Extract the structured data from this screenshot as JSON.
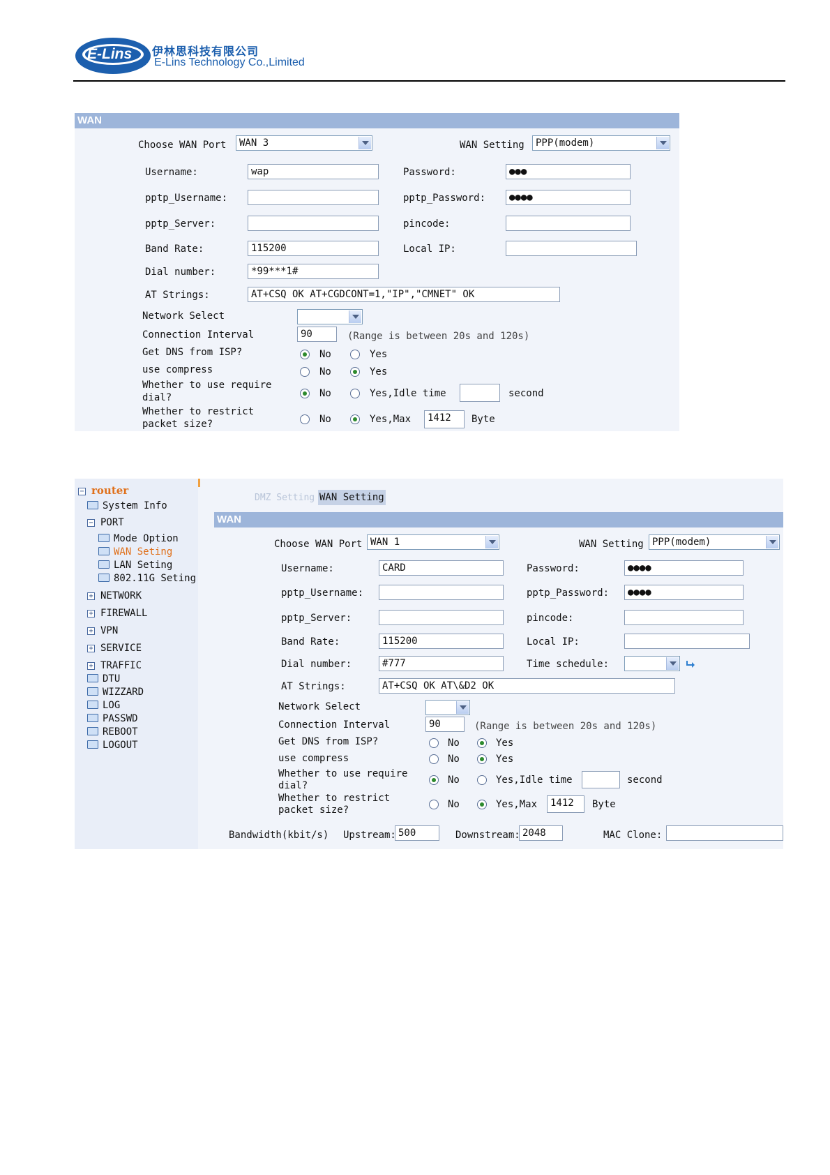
{
  "header": {
    "logo_text": "E-Lins",
    "company_cn": "伊林思科技有限公司",
    "company_en": "E-Lins Technology Co.,Limited"
  },
  "panel1": {
    "title": "WAN",
    "choose_wan_port_label": "Choose WAN Port",
    "choose_wan_port_value": "WAN 3",
    "wan_setting_label": "WAN Setting",
    "wan_setting_value": "PPP(modem)",
    "username_label": "Username:",
    "username_value": "wap",
    "password_label": "Password:",
    "password_value": "●●●",
    "pptp_username_label": "pptp_Username:",
    "pptp_username_value": "",
    "pptp_password_label": "pptp_Password:",
    "pptp_password_value": "●●●●",
    "pptp_server_label": "pptp_Server:",
    "pptp_server_value": "",
    "pincode_label": "pincode:",
    "pincode_value": "",
    "band_rate_label": "Band Rate:",
    "band_rate_value": "115200",
    "local_ip_label": "Local IP:",
    "local_ip_value": "",
    "dial_number_label": "Dial number:",
    "dial_number_value": "*99***1#",
    "at_strings_label": "AT Strings:",
    "at_strings_value": "AT+CSQ OK AT+CGDCONT=1,\"IP\",\"CMNET\" OK",
    "network_select_label": "Network Select",
    "network_select_value": "",
    "connection_interval_label": "Connection Interval",
    "connection_interval_value": "90",
    "range_note": "(Range is between 20s and 120s)",
    "dns_label": "Get DNS from ISP?",
    "compress_label": "use compress",
    "require_dial_label_1": "Whether to use require",
    "require_dial_label_2": "dial?",
    "restrict_label_1": "Whether to restrict",
    "restrict_label_2": "packet size?",
    "no": "No",
    "yes": "Yes",
    "yes_idle_time": "Yes,Idle time",
    "idle_value": "",
    "second": "second",
    "yes_max": "Yes,Max",
    "max_value": "1412",
    "byte": "Byte",
    "dns_choice": "No",
    "compress_choice": "Yes",
    "require_dial_choice": "No",
    "restrict_choice": "Yes"
  },
  "panel2": {
    "sidebar": {
      "root": "router",
      "items": [
        {
          "label": "System Info"
        },
        {
          "label": "PORT"
        },
        {
          "label": "Mode Option"
        },
        {
          "label": "WAN Seting"
        },
        {
          "label": "LAN Seting"
        },
        {
          "label": "802.11G Seting"
        },
        {
          "label": "NETWORK"
        },
        {
          "label": "FIREWALL"
        },
        {
          "label": "VPN"
        },
        {
          "label": "SERVICE"
        },
        {
          "label": "TRAFFIC"
        },
        {
          "label": "DTU"
        },
        {
          "label": "WIZZARD"
        },
        {
          "label": "LOG"
        },
        {
          "label": "PASSWD"
        },
        {
          "label": "REBOOT"
        },
        {
          "label": "LOGOUT"
        }
      ],
      "active_color": "#e0701a"
    },
    "tabs": {
      "dmz": "DMZ Setting",
      "wan": "WAN Setting"
    },
    "title": "WAN",
    "choose_wan_port_label": "Choose WAN Port",
    "choose_wan_port_value": "WAN 1",
    "wan_setting_label": "WAN Setting",
    "wan_setting_value": "PPP(modem)",
    "username_label": "Username:",
    "username_value": "CARD",
    "password_label": "Password:",
    "password_value": "●●●●",
    "pptp_username_label": "pptp_Username:",
    "pptp_username_value": "",
    "pptp_password_label": "pptp_Password:",
    "pptp_password_value": "●●●●",
    "pptp_server_label": "pptp_Server:",
    "pptp_server_value": "",
    "pincode_label": "pincode:",
    "pincode_value": "",
    "band_rate_label": "Band Rate:",
    "band_rate_value": "115200",
    "local_ip_label": "Local IP:",
    "local_ip_value": "",
    "dial_number_label": "Dial number:",
    "dial_number_value": "#777",
    "time_schedule_label": "Time schedule:",
    "time_schedule_value": "",
    "at_strings_label": "AT Strings:",
    "at_strings_value": "AT+CSQ OK AT\\&D2 OK",
    "network_select_label": "Network Select",
    "network_select_value": "",
    "connection_interval_label": "Connection Interval",
    "connection_interval_value": "90",
    "range_note": "(Range is between 20s and 120s)",
    "dns_label": "Get DNS from ISP?",
    "compress_label": "use compress",
    "require_dial_label_1": "Whether to use require",
    "require_dial_label_2": "dial?",
    "restrict_label_1": "Whether to restrict",
    "restrict_label_2": "packet size?",
    "no": "No",
    "yes": "Yes",
    "yes_idle_time": "Yes,Idle time",
    "idle_value": "",
    "second": "second",
    "yes_max": "Yes,Max",
    "max_value": "1412",
    "byte": "Byte",
    "bandwidth_label": "Bandwidth(kbit/s)",
    "upstream_label": "Upstream:",
    "upstream_value": "500",
    "downstream_label": "Downstream:",
    "downstream_value": "2048",
    "mac_clone_label": "MAC Clone:",
    "mac_clone_value": "",
    "dns_choice": "Yes",
    "compress_choice": "Yes",
    "require_dial_choice": "No",
    "restrict_choice": "Yes"
  }
}
